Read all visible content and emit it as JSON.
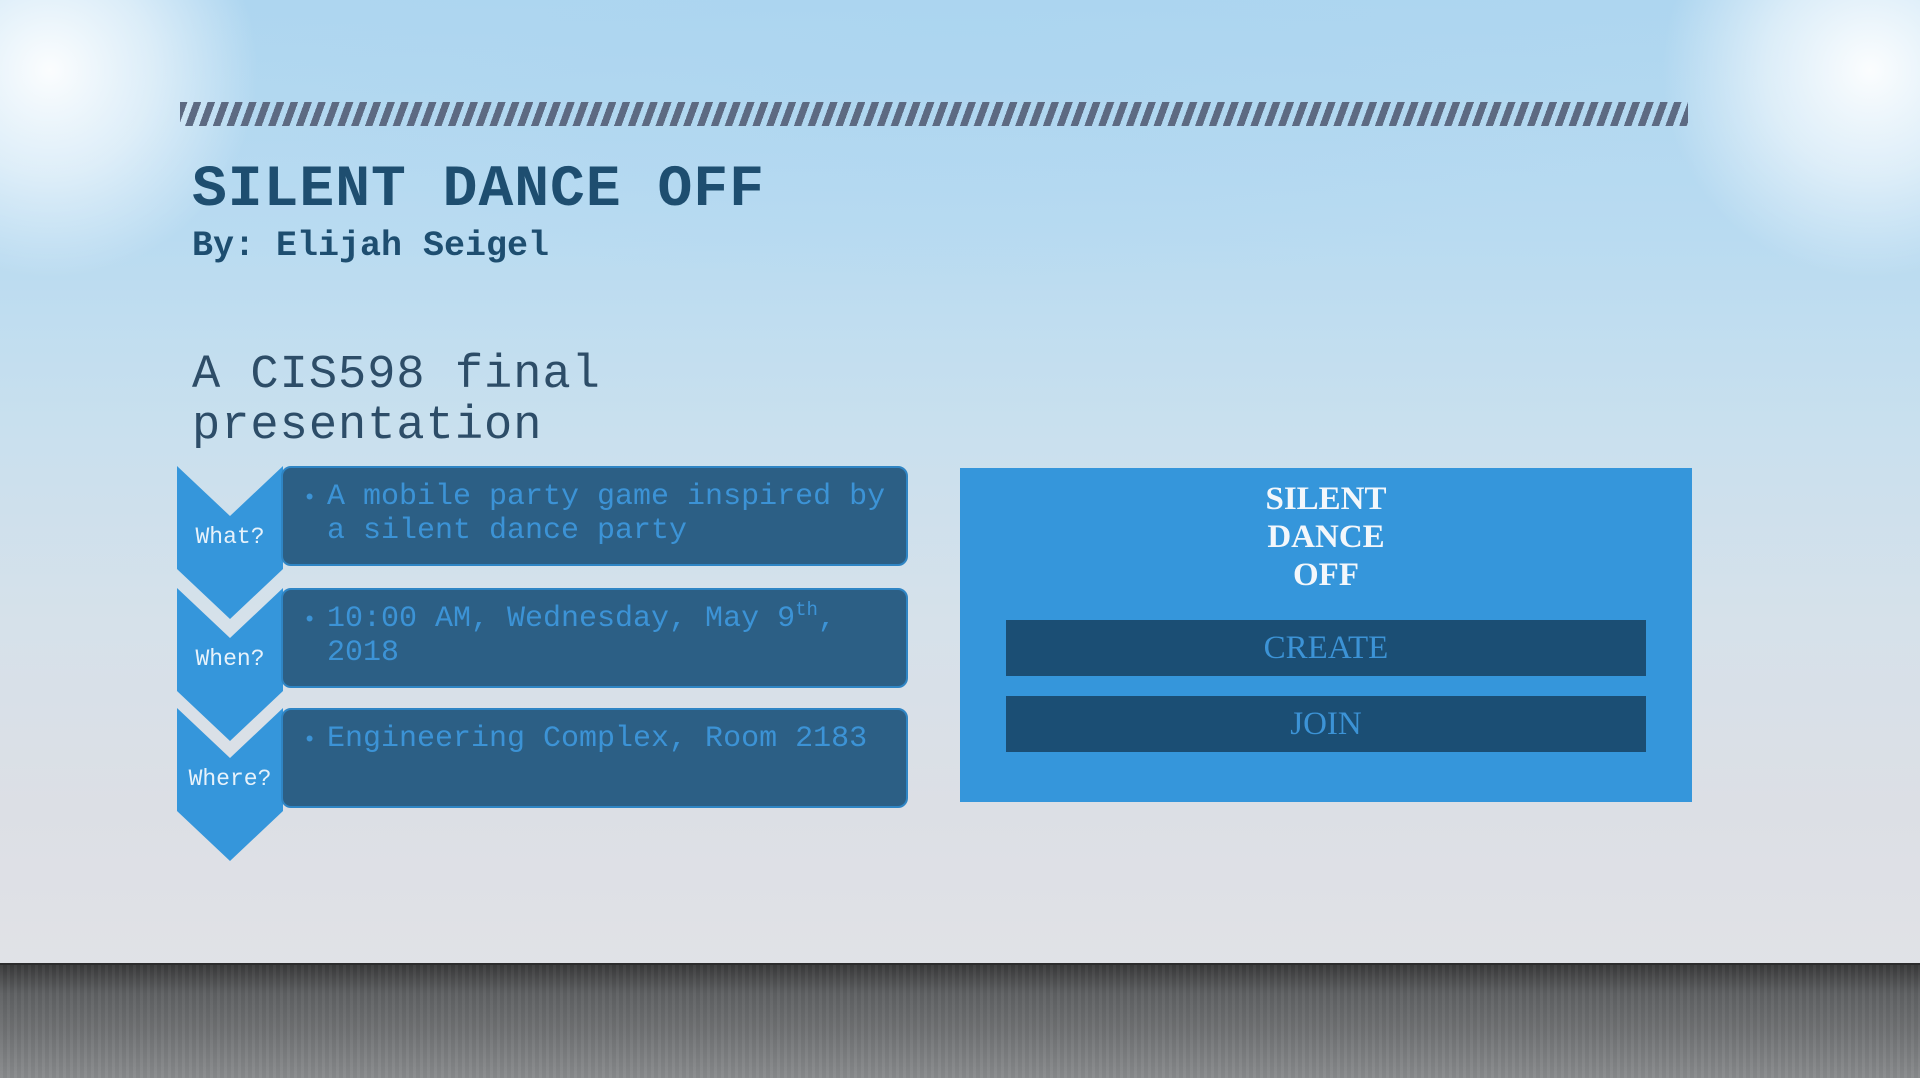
{
  "slide": {
    "title": "SILENT DANCE OFF",
    "byline": "By: Elijah Seigel",
    "subtitle": "A CIS598 final presentation"
  },
  "details": [
    {
      "label": "What?",
      "text": "A mobile party game inspired by a silent dance party",
      "suffix": ""
    },
    {
      "label": "When?",
      "text": "10:00 AM, Wednesday, May 9",
      "sup": "th",
      "suffix": ", 2018"
    },
    {
      "label": "Where?",
      "text": "Engineering Complex,  Room 2183",
      "suffix": ""
    }
  ],
  "app_preview": {
    "title_lines": [
      "SILENT",
      "DANCE",
      "OFF"
    ],
    "create_label": "CREATE",
    "join_label": "JOIN"
  },
  "colors": {
    "title": "#1e4e70",
    "chevron": "#3596db",
    "info_box": "#2c5f85",
    "panel": "#3596db",
    "panel_button": "#1b4e74"
  }
}
